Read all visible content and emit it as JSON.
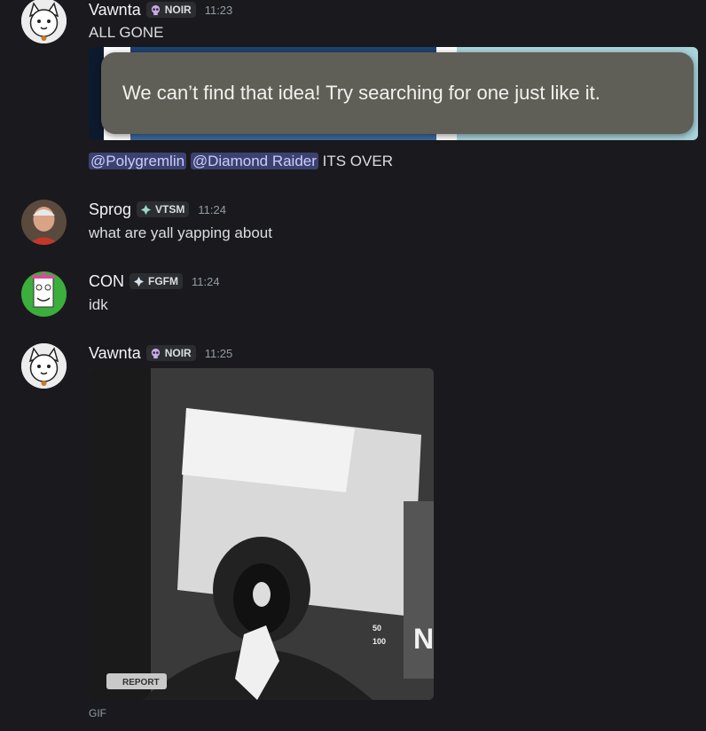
{
  "messages": [
    {
      "username": "Vawnta",
      "tag": "NOIR",
      "tag_icon": "skull-icon",
      "time": "11:23",
      "text": "ALL GONE",
      "reply": {
        "mentions": [
          "@Polygremlin",
          "@Diamond Raider"
        ],
        "text": "ITS OVER"
      }
    },
    {
      "username": "Sprog",
      "tag": "VTSM",
      "tag_icon": "diamond-sparkle-icon",
      "time": "11:24",
      "text": "what are yall yapping about"
    },
    {
      "username": "CON",
      "tag": "FGFM",
      "tag_icon": "diamond-sparkle-icon",
      "time": "11:24",
      "text": "idk"
    },
    {
      "username": "Vawnta",
      "tag": "NOIR",
      "tag_icon": "skull-icon",
      "time": "11:25",
      "attachment_label": "GIF",
      "gif_overlay": {
        "report": "REPORT",
        "stat_a": "50",
        "stat_b": "100",
        "letter": "N"
      }
    }
  ],
  "toast": {
    "text": "We can’t find that idea! Try searching for one just like it."
  },
  "colors": {
    "background": "#1a1a1e",
    "mention_bg": "#3c4270",
    "mention_text": "#c9cdfb",
    "toast_bg": "#5f5e57"
  }
}
